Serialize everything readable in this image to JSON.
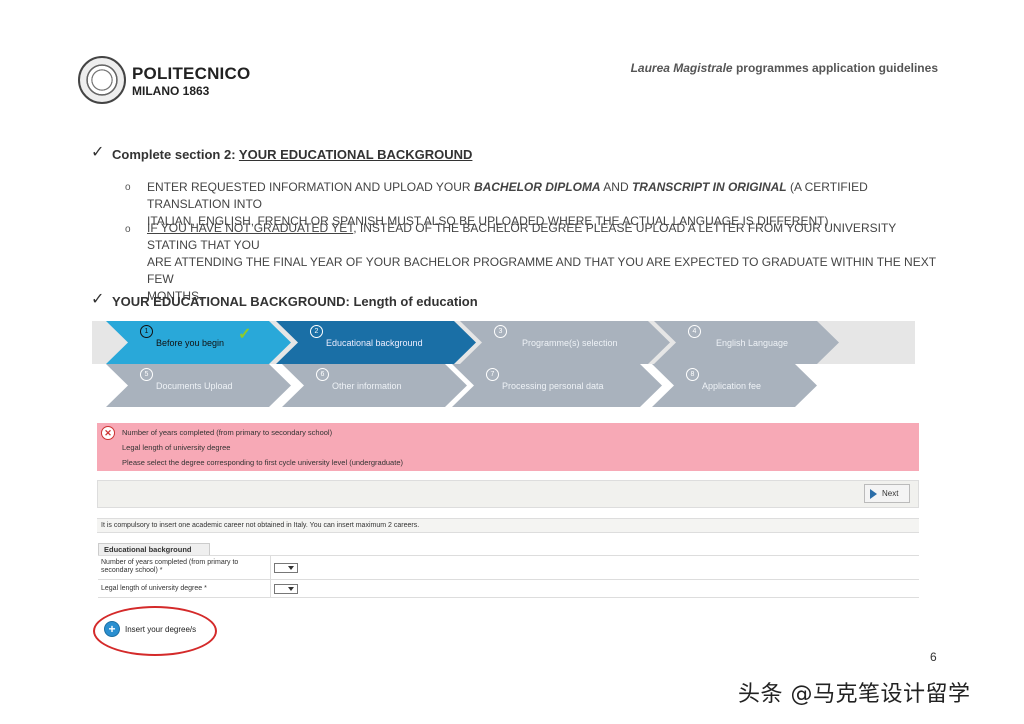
{
  "header": {
    "logo_name": "POLITECNICO",
    "logo_sub": "MILANO 1863",
    "doc_title_italic": "Laurea Magistrale",
    "doc_title_rest": " programmes application guidelines"
  },
  "section1": {
    "prefix": "Complete section 2: ",
    "title": "YOUR EDUCATIONAL BACKGROUND",
    "bullet1_a": "ENTER REQUESTED INFORMATION AND UPLOAD YOUR ",
    "bullet1_b": "BACHELOR DIPLOMA",
    "bullet1_c": " AND ",
    "bullet1_d": "TRANSCRIPT IN ORIGINAL",
    "bullet1_e": " (A CERTIFIED TRANSLATION INTO",
    "bullet1_line2": "ITALIAN, ENGLISH, FRENCH OR SPANISH MUST ALSO BE UPLOADED WHERE THE ACTUAL LANGUAGE IS DIFFERENT)",
    "bullet2_ul": "IF YOU HAVE NOT GRADUATED YET",
    "bullet2_rest": ",  INSTEAD OF THE BACHELOR DEGREE PLEASE UPLOAD A LETTER FROM YOUR UNIVERSITY STATING THAT YOU",
    "bullet2_line2": "ARE  ATTENDING THE FINAL YEAR OF YOUR BACHELOR PROGRAMME  AND THAT YOU ARE EXPECTED TO GRADUATE WITHIN THE NEXT FEW",
    "bullet2_line3": "MONTHS."
  },
  "section2": {
    "title_bold": "YOUR EDUCATIONAL BACKGROUND",
    "title_rest": ": Length of education"
  },
  "wizard": {
    "steps": [
      {
        "num": "1",
        "label": "Before you begin"
      },
      {
        "num": "2",
        "label": "Educational background"
      },
      {
        "num": "3",
        "label": "Programme(s) selection"
      },
      {
        "num": "4",
        "label": "English Language"
      },
      {
        "num": "5",
        "label": "Documents Upload"
      },
      {
        "num": "6",
        "label": "Other information"
      },
      {
        "num": "7",
        "label": "Processing personal data"
      },
      {
        "num": "8",
        "label": "Application fee"
      }
    ]
  },
  "errors": [
    "Number of years completed (from primary to secondary school)",
    "Legal length of university degree",
    "Please select the degree corresponding to first cycle university level (undergraduate)"
  ],
  "toolbar": {
    "next_label": "Next"
  },
  "info": "It is compulsory to insert one academic career not obtained in Italy. You can insert maximum 2 careers.",
  "table": {
    "header": "Educational background",
    "row1_label": "Number of years completed (from primary to secondary school) *",
    "row2_label": "Legal length of university degree *"
  },
  "insert_label": "Insert your degree/s",
  "page_number": "6",
  "watermark": "头条 @马克笔设计留学",
  "colors": {
    "error_bg": "#f7a9b6",
    "step_active": "#29a8d9",
    "step_current": "#1a6fa6",
    "step_inactive": "#a9b2bd",
    "oval": "#d42a2a"
  }
}
